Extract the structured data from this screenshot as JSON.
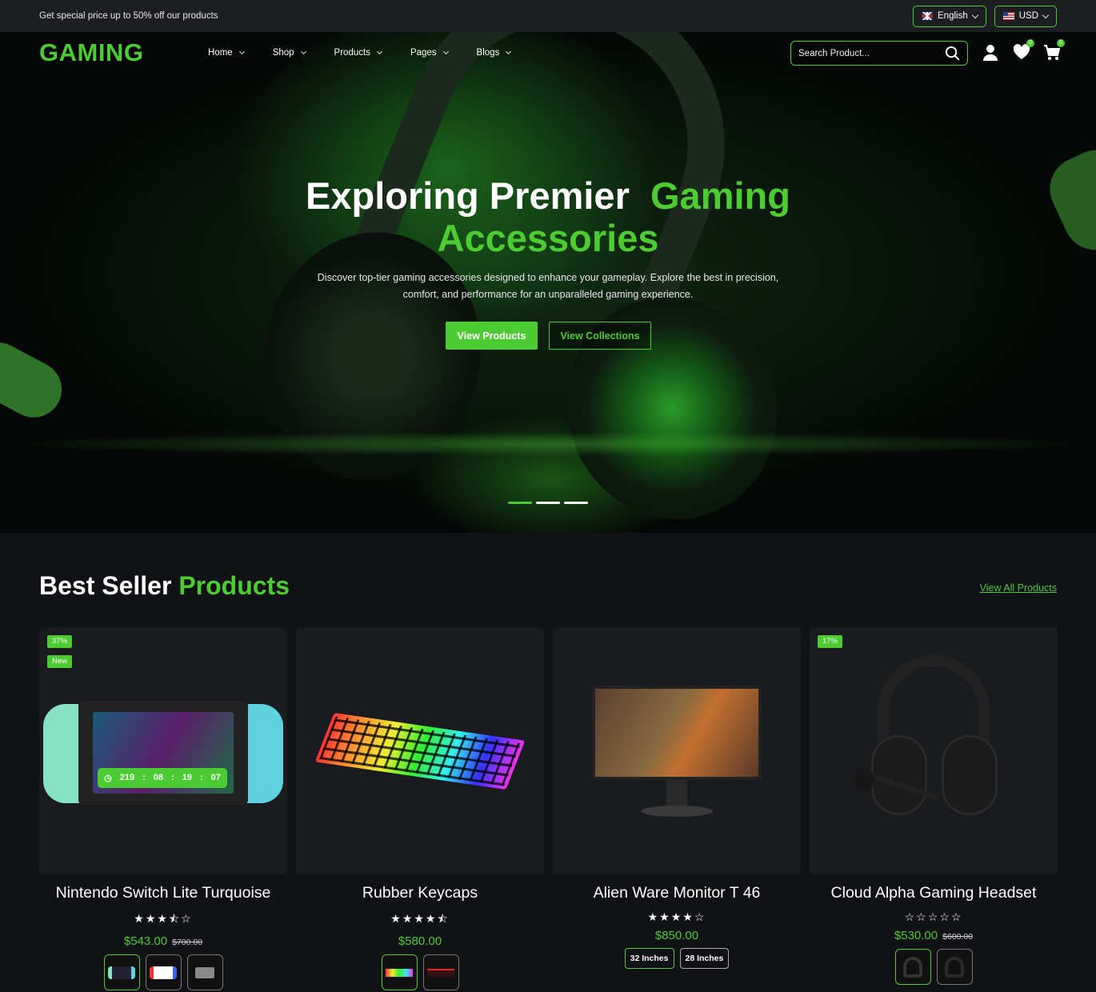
{
  "topbar": {
    "promo": "Get special price up to 50% off our products",
    "language": "English",
    "currency": "USD"
  },
  "nav": {
    "logo": "GAMING",
    "menu": [
      "Home",
      "Shop",
      "Products",
      "Pages",
      "Blogs"
    ],
    "search_placeholder": "Search Product...",
    "wishlist_count": "0",
    "cart_count": "0"
  },
  "hero": {
    "title_white": "Exploring Premier",
    "title_green_1": "Gaming",
    "title_green_2": "Accessories",
    "description": "Discover top-tier gaming accessories designed to enhance your gameplay. Explore the best in precision, comfort, and performance for an unparalleled gaming experience.",
    "btn_primary": "View Products",
    "btn_secondary": "View Collections",
    "slides": 3,
    "active_slide": 1
  },
  "best_sellers": {
    "title_white": "Best Seller",
    "title_green": "Products",
    "view_all": "View All Products",
    "products": [
      {
        "name": "Nintendo Switch Lite Turquoise",
        "stars": "★★★⯪☆",
        "price": "$543.00",
        "old_price": "$700.00",
        "discount": "37%",
        "new_label": "New",
        "timer": [
          "219",
          "08",
          "19",
          "07"
        ]
      },
      {
        "name": "Rubber Keycaps",
        "stars": "★★★★⯪",
        "price": "$580.00"
      },
      {
        "name": "Alien Ware Monitor T 46",
        "stars": "★★★★☆",
        "price": "$850.00",
        "sizes": [
          "32 Inches",
          "28 Inches"
        ]
      },
      {
        "name": "Cloud Alpha Gaming Headset",
        "stars": "☆☆☆☆☆",
        "price": "$530.00",
        "old_price": "$600.00",
        "discount": "17%"
      }
    ]
  },
  "colors": {
    "accent": "#4ccb32",
    "background": "#111215",
    "card": "#1a1b1f"
  }
}
